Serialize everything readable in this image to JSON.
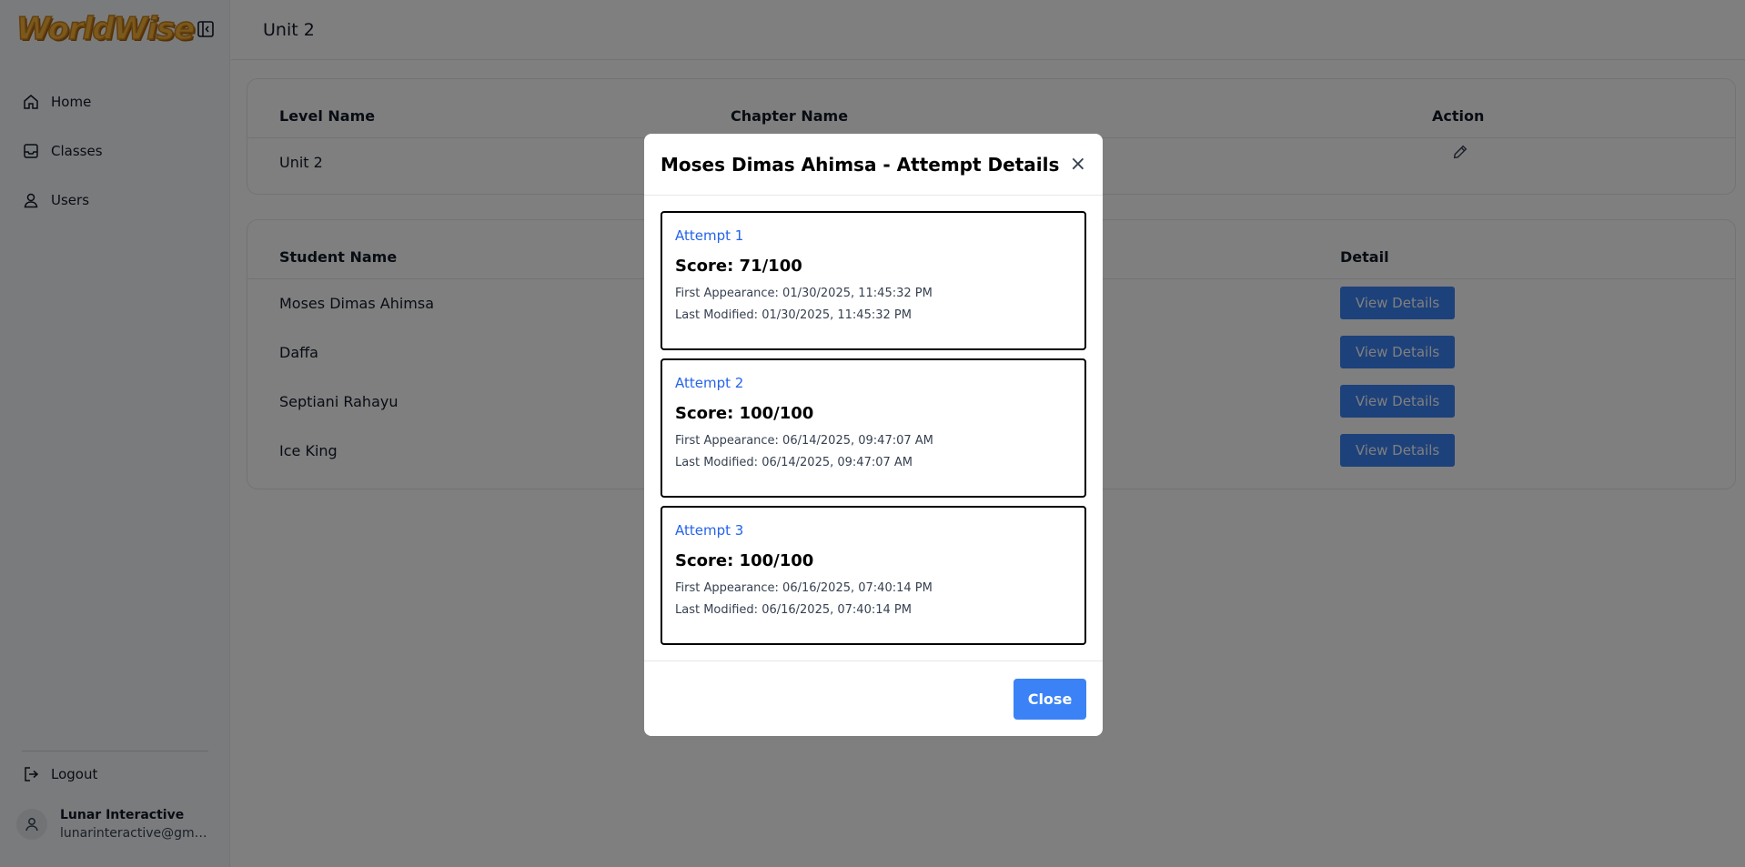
{
  "app": {
    "logo": "WorldWise"
  },
  "sidebar": {
    "items": [
      {
        "label": "Home",
        "icon": "home-icon"
      },
      {
        "label": "Classes",
        "icon": "inbox-icon"
      },
      {
        "label": "Users",
        "icon": "user-icon"
      }
    ],
    "logout_label": "Logout",
    "user": {
      "name": "Lunar Interactive",
      "email": "lunarinteractive@gmail.com"
    }
  },
  "header": {
    "title": "Unit 2"
  },
  "level_table": {
    "columns": [
      "Level Name",
      "Chapter Name",
      "Action"
    ],
    "rows": [
      {
        "level": "Unit 2",
        "chapter": ""
      }
    ]
  },
  "student_table": {
    "columns": [
      "Student Name",
      "",
      "Detail"
    ],
    "rows": [
      {
        "name": "Moses Dimas Ahimsa",
        "button": "View Details"
      },
      {
        "name": "Daffa",
        "button": "View Details"
      },
      {
        "name": "Septiani Rahayu",
        "button": "View Details"
      },
      {
        "name": "Ice King",
        "button": "View Details"
      }
    ]
  },
  "modal": {
    "title": "Moses Dimas Ahimsa - Attempt Details",
    "close_symbol": "×",
    "attempts": [
      {
        "title": "Attempt 1",
        "score": "Score: 71/100",
        "first": "First Appearance: 01/30/2025, 11:45:32 PM",
        "last": "Last Modified: 01/30/2025, 11:45:32 PM"
      },
      {
        "title": "Attempt 2",
        "score": "Score: 100/100",
        "first": "First Appearance: 06/14/2025, 09:47:07 AM",
        "last": "Last Modified: 06/14/2025, 09:47:07 AM"
      },
      {
        "title": "Attempt 3",
        "score": "Score: 100/100",
        "first": "First Appearance: 06/16/2025, 07:40:14 PM",
        "last": "Last Modified: 06/16/2025, 07:40:14 PM"
      }
    ],
    "close_button": "Close"
  },
  "colors": {
    "accent": "#3b82f6",
    "attempt_title": "#2563eb",
    "logo": "#f6b33b"
  }
}
